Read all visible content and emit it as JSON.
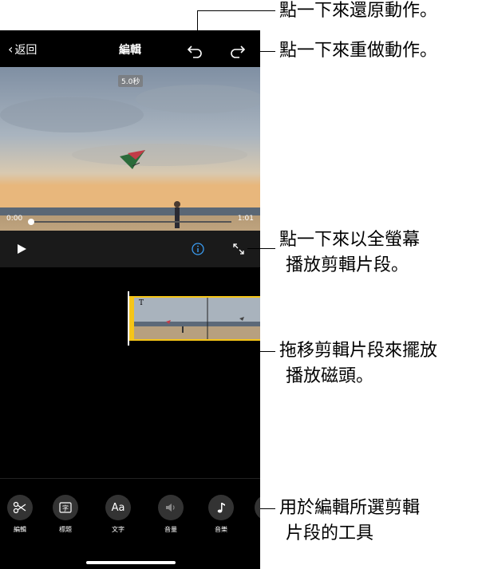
{
  "nav": {
    "back_label": "返回",
    "title": "編輯"
  },
  "preview": {
    "duration_badge": "5.0秒"
  },
  "scrubber": {
    "current_time": "0:00",
    "total_time": "1:01",
    "progress": 0.0
  },
  "toolbar": {
    "tools": [
      {
        "label": "編輯",
        "icon": "scissors-icon"
      },
      {
        "label": "標題",
        "icon": "title-icon"
      },
      {
        "label": "文字",
        "icon": "text-icon",
        "glyph": "Aa"
      },
      {
        "label": "音量",
        "icon": "volume-icon"
      },
      {
        "label": "音樂",
        "icon": "music-note-icon"
      }
    ]
  },
  "callouts": {
    "undo": "點一下來還原動作。",
    "redo": "點一下來重做動作。",
    "fullscreen_1": "點一下來以全螢幕",
    "fullscreen_2": "播放剪輯片段。",
    "drag_1": "拖移剪輯片段來擺放",
    "drag_2": "播放磁頭。",
    "tools_1": "用於編輯所選剪輯",
    "tools_2": "片段的工具"
  },
  "colors": {
    "accent": "#f5c518",
    "info": "#3a9bf0",
    "background": "#000000"
  }
}
